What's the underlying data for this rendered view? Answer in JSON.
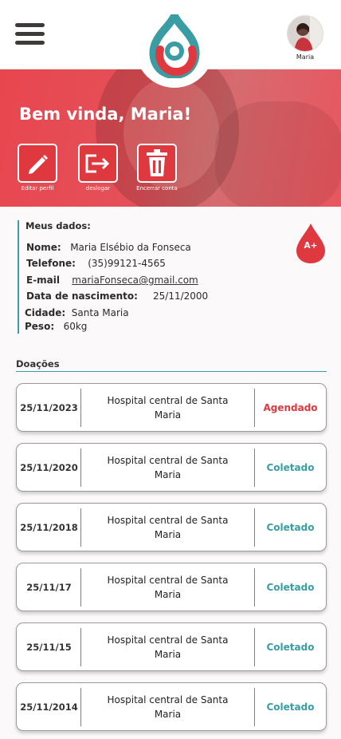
{
  "header": {
    "user_name": "Maria",
    "welcome": "Bem vinda, Maria!"
  },
  "actions": [
    {
      "label": "Editar perfil",
      "icon": "pencil-icon"
    },
    {
      "label": "deslogar",
      "icon": "logout-icon"
    },
    {
      "label": "Encerrar conta",
      "icon": "trash-icon"
    }
  ],
  "profile": {
    "title": "Meus dados:",
    "name_label": "Nome:",
    "name": "Maria Elsébio da Fonseca",
    "phone_label": "Telefone:",
    "phone": "(35)99121-4565",
    "email_label": "E-mail",
    "email": "mariaFonseca@gmail.com",
    "birth_label": "Data de nascimento:",
    "birth": "25/11/2000",
    "city_label": "Cidade:",
    "city": "Santa Maria",
    "weight_label": "Peso:",
    "weight": "60kg",
    "blood_type": "A+"
  },
  "donations": {
    "title": "Doações",
    "items": [
      {
        "date": "25/11/2023",
        "place": "Hospital central de Santa Maria",
        "status": "Agendado"
      },
      {
        "date": "25/11/2020",
        "place": "Hospital central de Santa Maria",
        "status": "Coletado"
      },
      {
        "date": "25/11/2018",
        "place": "Hospital central de Santa Maria",
        "status": "Coletado"
      },
      {
        "date": "25/11/17",
        "place": "Hospital central de Santa Maria",
        "status": "Coletado"
      },
      {
        "date": "25/11/15",
        "place": "Hospital central de Santa Maria",
        "status": "Coletado"
      },
      {
        "date": "25/11/2014",
        "place": "Hospital central de Santa Maria",
        "status": "Coletado"
      }
    ]
  },
  "colors": {
    "brand_red": "#e0383f",
    "accent_teal": "#3a9da3",
    "scheduled": "#e0383f",
    "collected": "#3a9da3"
  }
}
